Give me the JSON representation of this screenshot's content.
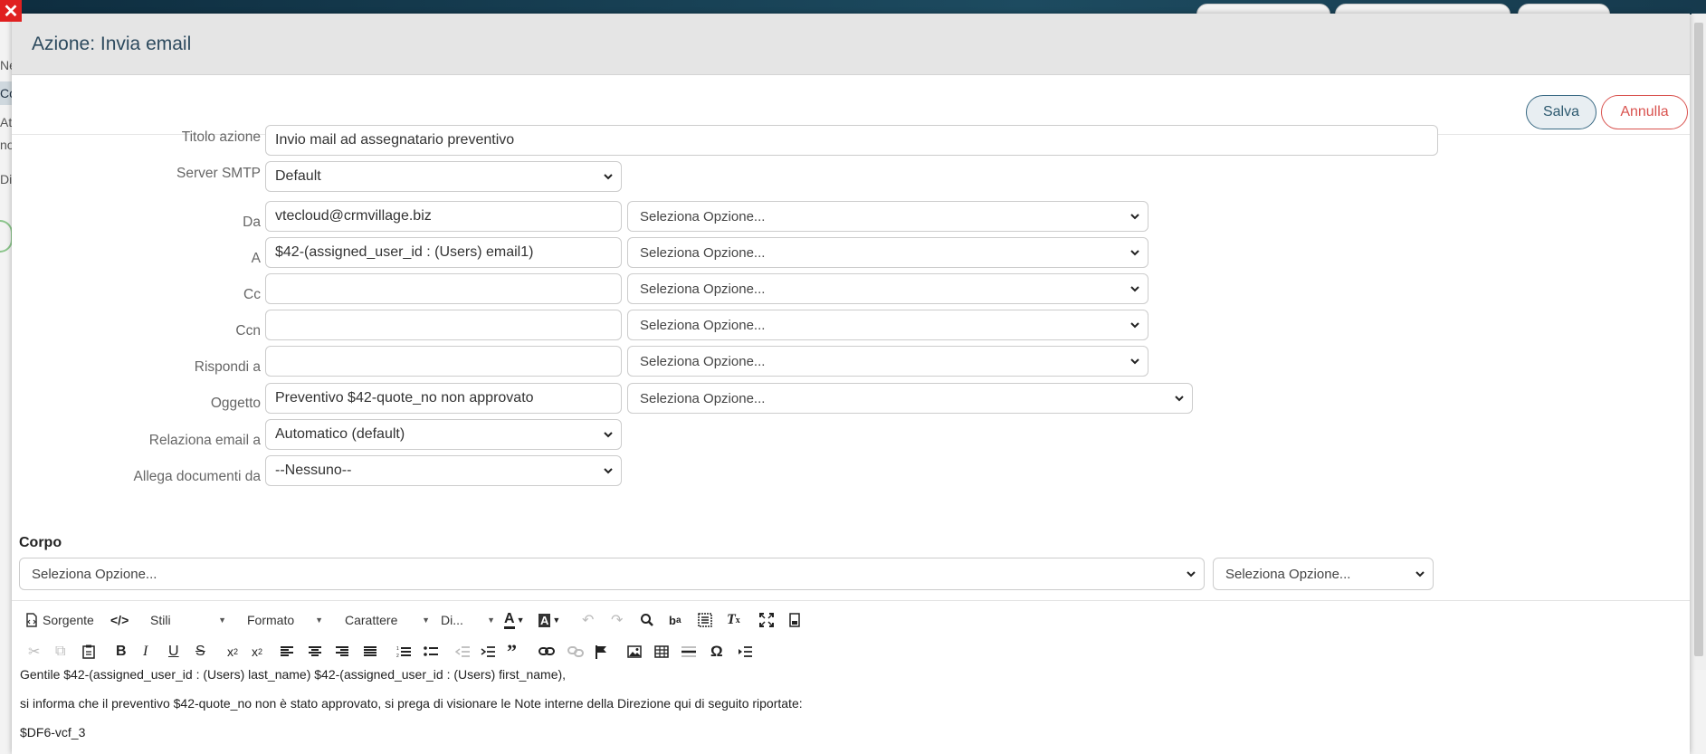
{
  "background": {
    "behind_texts": [
      "Ne",
      "Co",
      "At",
      "no",
      "Di"
    ]
  },
  "modal": {
    "title": "Azione: Invia email",
    "save_label": "Salva",
    "cancel_label": "Annulla"
  },
  "form": {
    "titolo_azione": {
      "label": "Titolo azione",
      "value": "Invio mail ad assegnatario preventivo"
    },
    "server_smtp": {
      "label": "Server SMTP",
      "value": "Default"
    },
    "da": {
      "label": "Da",
      "value": "vtecloud@crmvillage.biz",
      "option": "Seleziona Opzione..."
    },
    "a": {
      "label": "A",
      "value": "$42-(assigned_user_id : (Users) email1)",
      "option": "Seleziona Opzione..."
    },
    "cc": {
      "label": "Cc",
      "value": "",
      "option": "Seleziona Opzione..."
    },
    "ccn": {
      "label": "Ccn",
      "value": "",
      "option": "Seleziona Opzione..."
    },
    "rispondi_a": {
      "label": "Rispondi a",
      "value": "",
      "option": "Seleziona Opzione..."
    },
    "oggetto": {
      "label": "Oggetto",
      "value": "Preventivo $42-quote_no non approvato",
      "option": "Seleziona Opzione..."
    },
    "relaziona": {
      "label": "Relaziona email a",
      "value": "Automatico (default)"
    },
    "allega": {
      "label": "Allega documenti da",
      "value": "--Nessuno--"
    }
  },
  "corpo": {
    "label": "Corpo",
    "option1": "Seleziona Opzione...",
    "option2": "Seleziona Opzione..."
  },
  "toolbar": {
    "source_label": "Sorgente",
    "styles_label": "Stili",
    "format_label": "Formato",
    "font_label": "Carattere",
    "size_label": "Di..."
  },
  "body": {
    "line1": "Gentile $42-(assigned_user_id : (Users) last_name) $42-(assigned_user_id : (Users) first_name),",
    "line2": "si informa che il preventivo $42-quote_no non è stato approvato, si prega di visionare le Note interne della Direzione qui di seguito riportate:",
    "line3": "$DF6-vcf_3"
  }
}
